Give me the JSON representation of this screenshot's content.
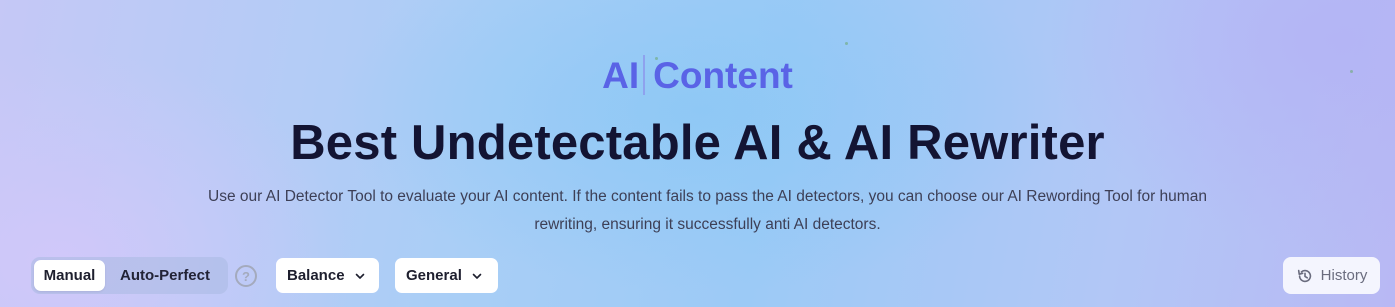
{
  "hero": {
    "kicker_left": "AI",
    "kicker_right": "Content",
    "title": "Best Undetectable AI & AI Rewriter",
    "description": "Use our AI Detector Tool to evaluate your AI content. If the content fails to pass the AI detectors, you can choose our AI Rewording Tool for human rewriting, ensuring it successfully anti AI detectors."
  },
  "toolbar": {
    "modes": [
      {
        "label": "Manual",
        "selected": true
      },
      {
        "label": "Auto-Perfect",
        "selected": false
      }
    ],
    "help_icon": "question-circle-icon",
    "help_label": "?",
    "dropdowns": [
      {
        "label": "Balance",
        "icon": "chevron-down-icon"
      },
      {
        "label": "General",
        "icon": "chevron-down-icon"
      }
    ],
    "history": {
      "label": "History",
      "icon": "history-icon"
    }
  },
  "colors": {
    "accent": "#5a63e6",
    "title": "#131433",
    "text": "#3d3f56"
  }
}
